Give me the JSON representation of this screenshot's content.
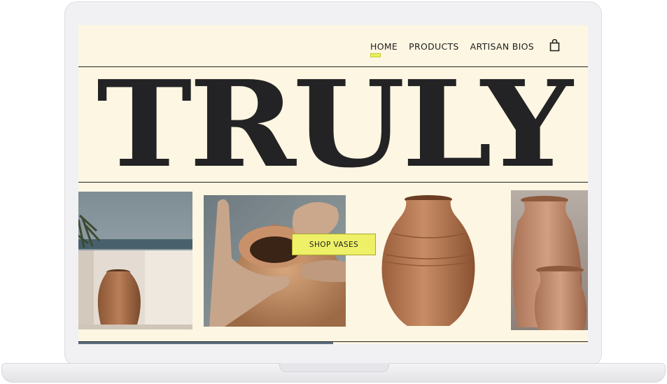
{
  "nav": {
    "home": "HOME",
    "products": "PRODUCTS",
    "artisan_bios": "ARTISAN BIOS",
    "cart_icon": "shopping-bag-icon"
  },
  "hero": {
    "headline": "TRULY",
    "cta_label": "SHOP VASES"
  },
  "gallery": {
    "progress": 0.5
  },
  "colors": {
    "background": "#fdf6e2",
    "ink": "#232325",
    "accent": "#eef067"
  }
}
